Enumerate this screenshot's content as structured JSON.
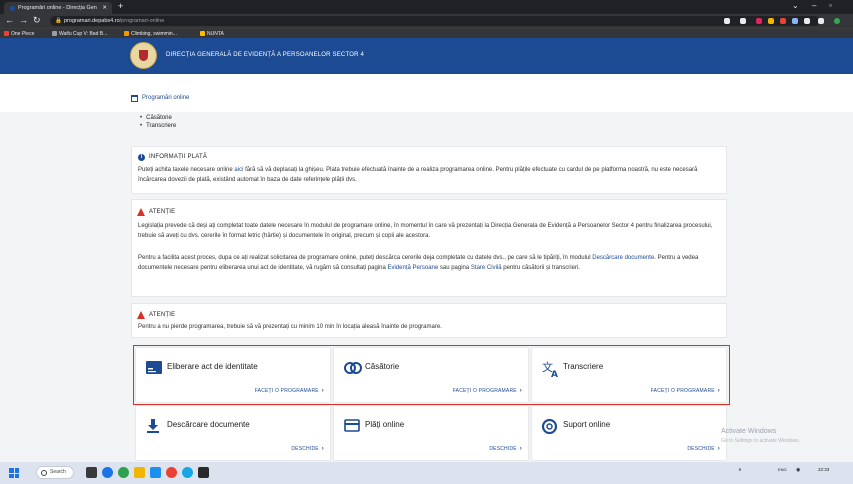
{
  "browser": {
    "tab_title": "Programări online - Direcția Gen",
    "tab_close": "✕",
    "new_tab": "+",
    "url_host": "programari.depabs4.ro",
    "url_path": "/programari-online",
    "bookmarks": [
      "One Piece",
      "Waifu Cup V: Bad B...",
      "Climbing, swimmin...",
      "NUNTA"
    ]
  },
  "site": {
    "title": "DIRECȚIA GENERALĂ DE EVIDENȚĂ A PERSOANELOR SECTOR 4",
    "page_link": "Programări online"
  },
  "list_items": [
    "Căsătorie",
    "Transcriere"
  ],
  "info_plata": {
    "title": "INFORMAȚII PLATĂ",
    "text_before": "Puteți achita taxele necesare online ",
    "link": "aici",
    "text_after": " fără să vă deplasați la ghișeu. Plata trebuie efectuată înainte de a realiza programarea online. Pentru plățile efectuate cu cardul de pe platforma noastră, nu este necesară încărcarea dovezii de plată, existând automat în baza de date referințele plății dvs."
  },
  "atentie1": {
    "title": "ATENȚIE",
    "p1": "Legislația prevede că deși ați completat toate datele necesare în modulul de programare online, în momentul în care vă prezentați la Direcția Generala de Evidență a Persoanelor Sector 4 pentru finalizarea procesului, trebuie să aveți cu dvs. cererile în format letric (hârtie) și documentele în original, precum și copii ale acestora.",
    "p2_a": "Pentru a facilita acest proces, dupa ce ați realizat solicitarea de programare online, puteți descărca cererile deja completate cu datele dvs., pe care să le tipăriți, în modulul ",
    "p2_link1": "Descărcare documente",
    "p2_b": ". Pentru a vedea documentele necesare pentru eliberarea unui act de identitate, vă rugăm să consultați pagina ",
    "p2_link2": "Evidență Persoane",
    "p2_c": " sau pagina ",
    "p2_link3": "Stare Civilă",
    "p2_d": " pentru căsătorii și transcrieri."
  },
  "atentie2": {
    "title": "ATENȚIE",
    "text": "Pentru a nu pierde programarea, trebuie să vă prezentați cu minim 10 min în locația aleasă înainte de programare."
  },
  "services": [
    {
      "label": "Eliberare act de identitate",
      "action": "FACEȚI O PROGRAMARE",
      "icon": "id-card-icon"
    },
    {
      "label": "Căsătorie",
      "action": "FACEȚI O PROGRAMARE",
      "icon": "rings-icon"
    },
    {
      "label": "Transcriere",
      "action": "FACEȚI O PROGRAMARE",
      "icon": "translate-icon"
    },
    {
      "label": "Descărcare documente",
      "action": "DESCHIDE",
      "icon": "download-icon"
    },
    {
      "label": "Plăți online",
      "action": "DESCHIDE",
      "icon": "card-icon"
    },
    {
      "label": "Suport online",
      "action": "DESCHIDE",
      "icon": "support-icon"
    }
  ],
  "windows": {
    "activate_title": "Activate Windows",
    "activate_sub": "Go to Settings to activate Windows.",
    "search": "Search",
    "lang": "ENG",
    "time": "22:33"
  },
  "colors": {
    "brand": "#1c4a93",
    "alert": "#d93025"
  }
}
